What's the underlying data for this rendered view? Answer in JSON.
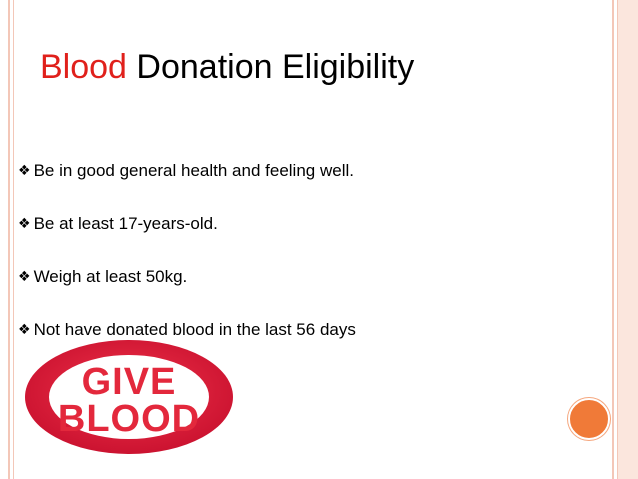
{
  "title": {
    "accent": "Blood",
    "rest": "Donation Eligibility"
  },
  "bullet_icon": "diamond-bullet-icon",
  "bullets": [
    "Be in good general health and feeling well.",
    "Be at least 17-years-old.",
    "Weigh at least 50kg.",
    "Not have donated blood in the last 56 days"
  ],
  "logo": {
    "line1": "GIVE",
    "line2": "BLOOD"
  },
  "colors": {
    "accent_red": "#e0201b",
    "logo_red": "#e3283c",
    "orange_dot": "#f07a38",
    "rule": "#f3c7b8"
  }
}
